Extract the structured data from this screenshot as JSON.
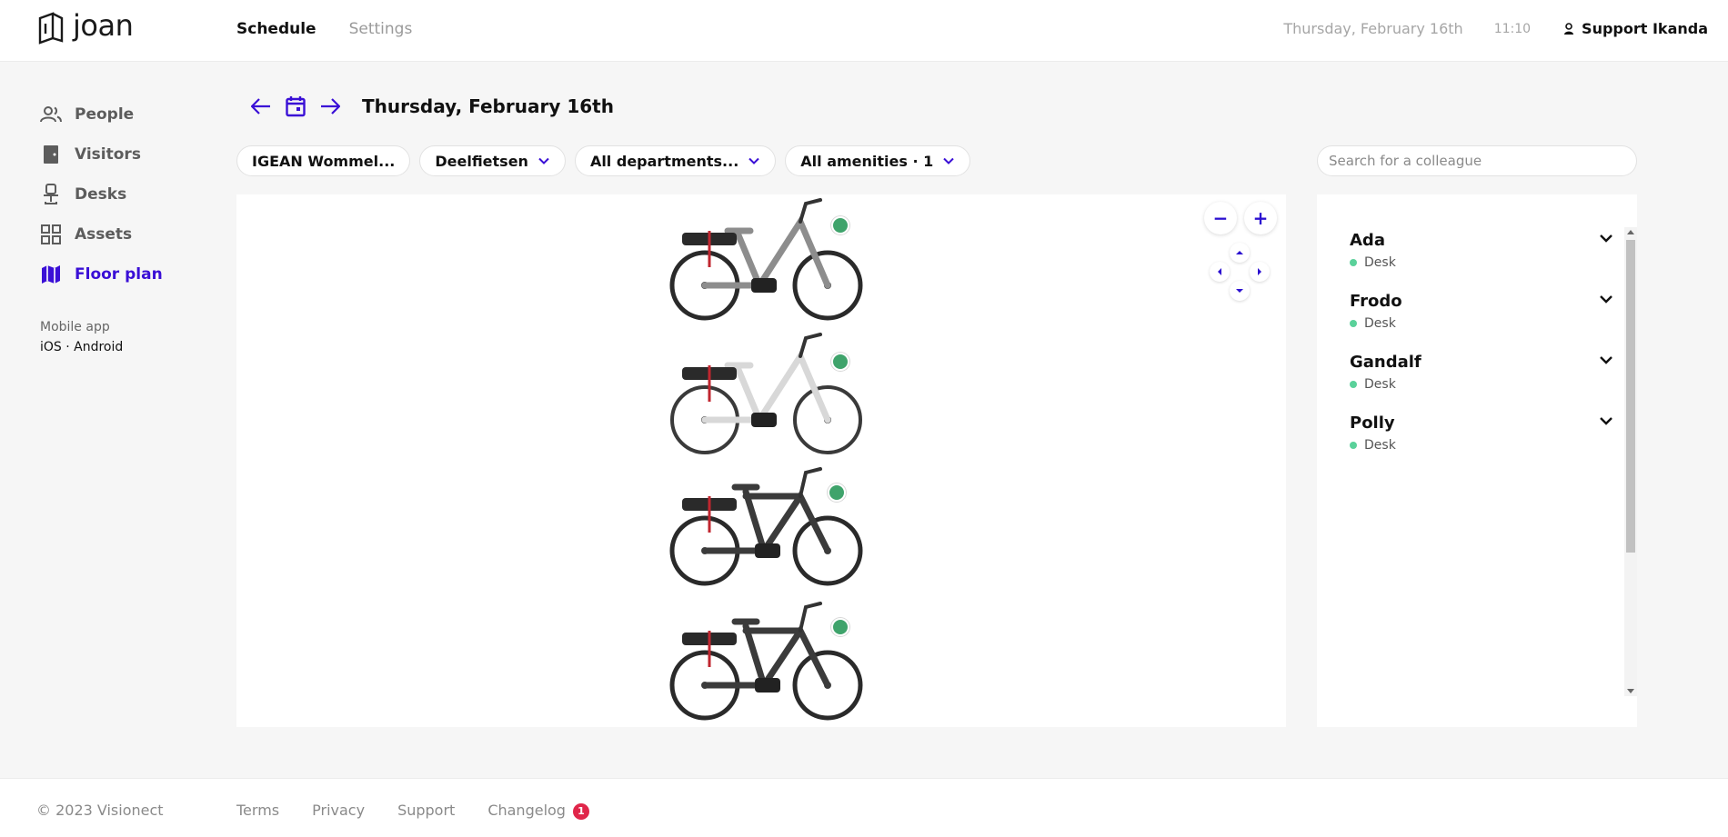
{
  "app": {
    "logo_text": "joan"
  },
  "topnav": {
    "schedule": "Schedule",
    "settings": "Settings"
  },
  "header": {
    "date": "Thursday, February 16th",
    "time": "11:10",
    "user": "Support Ikanda"
  },
  "sidebar": {
    "items": [
      {
        "label": "People",
        "icon": "people-icon"
      },
      {
        "label": "Visitors",
        "icon": "door-icon"
      },
      {
        "label": "Desks",
        "icon": "chair-icon"
      },
      {
        "label": "Assets",
        "icon": "grid-icon"
      },
      {
        "label": "Floor plan",
        "icon": "map-icon",
        "active": true
      }
    ],
    "mobile_label": "Mobile app",
    "mobile_links": "iOS · Android"
  },
  "datebar": {
    "title": "Thursday, February 16th"
  },
  "filters": {
    "location": "IGEAN Wommel...",
    "floor": "Deelfietsen",
    "departments": "All departments...",
    "amenities": "All amenities · 1"
  },
  "search": {
    "placeholder": "Search for a colleague"
  },
  "map": {
    "zoom_out": "−",
    "zoom_in": "+",
    "bikes": [
      {
        "frame": "#8d8d8d",
        "status": "available"
      },
      {
        "frame": "#e8e8e8",
        "status": "available"
      },
      {
        "frame": "#3b3b3b",
        "status": "available"
      },
      {
        "frame": "#3b3b3b",
        "status": "available"
      }
    ],
    "status_color": "#3fa36b"
  },
  "people": [
    {
      "name": "Ada",
      "type": "Desk"
    },
    {
      "name": "Frodo",
      "type": "Desk"
    },
    {
      "name": "Gandalf",
      "type": "Desk"
    },
    {
      "name": "Polly",
      "type": "Desk"
    }
  ],
  "footer": {
    "copyright": "© 2023 Visionect",
    "terms": "Terms",
    "privacy": "Privacy",
    "support": "Support",
    "changelog": "Changelog",
    "changelog_count": "1"
  },
  "colors": {
    "accent": "#3a0fd6",
    "available": "#5ad19a",
    "badge": "#e0264a"
  }
}
